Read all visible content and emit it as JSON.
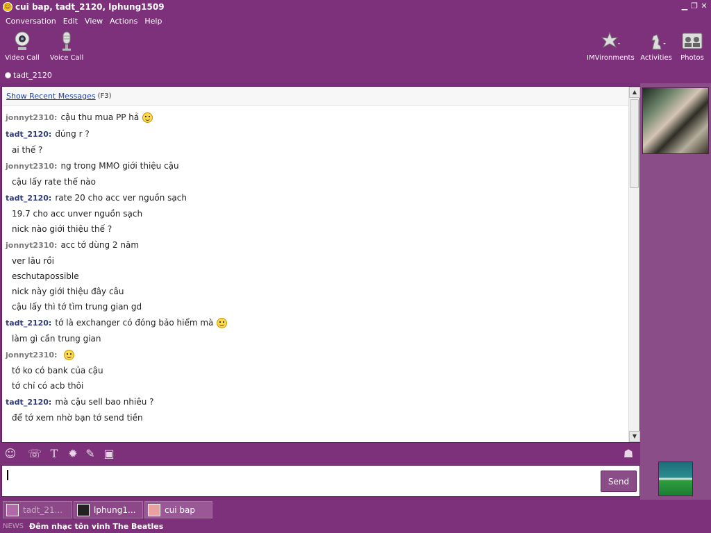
{
  "window": {
    "title": "cui bap, tadt_2120, lphung1509",
    "controls": [
      "minimize-icon",
      "restore-icon",
      "close-icon"
    ]
  },
  "menu": [
    "Conversation",
    "Edit",
    "View",
    "Actions",
    "Help"
  ],
  "toolbar": {
    "left": [
      {
        "label": "Video Call",
        "icon": "webcam-icon"
      },
      {
        "label": "Voice Call",
        "icon": "microphone-icon"
      }
    ],
    "right": [
      {
        "label": "IMVironments",
        "icon": "imvironment-icon"
      },
      {
        "label": "Activities",
        "icon": "chess-knight-icon"
      },
      {
        "label": "Photos",
        "icon": "photos-icon"
      }
    ]
  },
  "contact": {
    "name": "tadt_2120"
  },
  "chat": {
    "recent_link": "Show Recent Messages",
    "recent_key": "(F3)",
    "messages": [
      {
        "sender": "jonnyt2310:",
        "text": "cậu thu mua PP hả",
        "emoticon": true
      },
      {
        "sender": "tadt_2120:",
        "text": "đúng r ?"
      },
      {
        "text": "ai thế ?"
      },
      {
        "sender": "jonnyt2310:",
        "text": "ng trong MMO giới thiệu cậu"
      },
      {
        "text": "cậu lấy rate thế nào"
      },
      {
        "sender": "tadt_2120:",
        "text": "rate 20 cho acc ver nguồn sạch"
      },
      {
        "text": "19.7 cho acc unver nguồn sạch"
      },
      {
        "text": "nick nào giới thiệu thế ?"
      },
      {
        "sender": "jonnyt2310:",
        "text": "acc tớ dùng 2 năm"
      },
      {
        "text": "ver lâu rồi"
      },
      {
        "text": "eschutapossible"
      },
      {
        "text": "nick này giới thiệu đây câu"
      },
      {
        "text": "cậu lấy thì tớ tìm trung gian gd"
      },
      {
        "sender": "tadt_2120:",
        "text": "tớ là exchanger có đóng bảo hiểm mà",
        "emoticon": true
      },
      {
        "text": "làm gì cần trung gian"
      },
      {
        "sender": "jonnyt2310:",
        "text": "",
        "emoticon": true
      },
      {
        "text": "tớ ko có bank của cậu"
      },
      {
        "text": "tớ chỉ có acb thôi"
      },
      {
        "sender": "tadt_2120:",
        "text": "mà cậu sell bao nhiêu ?"
      },
      {
        "text": "để tớ xem nhờ bạn tớ send tiền"
      }
    ]
  },
  "format_bar": {
    "icons": [
      "emoticon-icon",
      "buzz-icon",
      "font-icon",
      "imvironment-icon",
      "attach-icon",
      "photo-share-icon"
    ],
    "right_icon": "add-contact-icon"
  },
  "input": {
    "value": "",
    "send_label": "Send"
  },
  "tabs": [
    {
      "label": "tadt_21...",
      "state": "inactive"
    },
    {
      "label": "lphung1...",
      "state": "normal"
    },
    {
      "label": "cui bap",
      "state": "active"
    }
  ],
  "news": {
    "label": "NEWS",
    "text": "Đêm nhạc tôn vinh The Beatles"
  },
  "colors": {
    "frame": "#7d317a",
    "sender_self": "#2f3b78",
    "sender_other": "#7a7a7a"
  }
}
